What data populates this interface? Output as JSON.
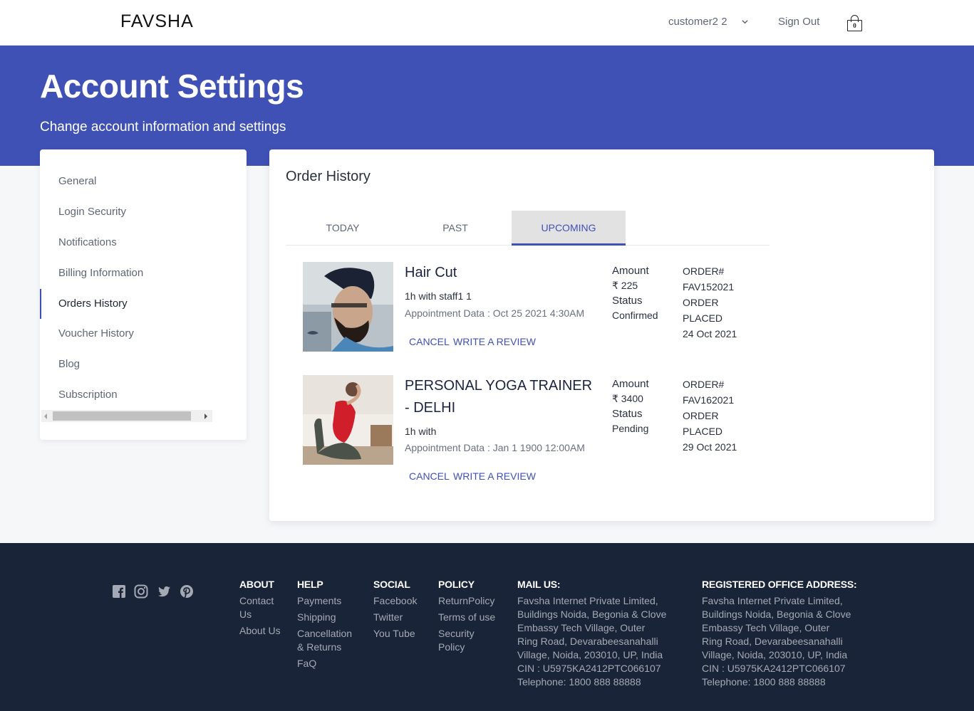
{
  "nav": {
    "logo": "FAVSHA",
    "user_name": "customer2 2",
    "sign_out": "Sign Out",
    "cart_count": "0"
  },
  "hero": {
    "title": "Account Settings",
    "subtitle": "Change account information and settings"
  },
  "sidebar": {
    "active": "Orders History",
    "items": [
      {
        "label": "General"
      },
      {
        "label": "Login Security"
      },
      {
        "label": "Notifications"
      },
      {
        "label": "Billing Information"
      },
      {
        "label": "Orders History"
      },
      {
        "label": "Voucher History"
      },
      {
        "label": "Blog"
      },
      {
        "label": "Subscription"
      }
    ]
  },
  "main": {
    "title": "Order History",
    "tabs": [
      {
        "label": "TODAY"
      },
      {
        "label": "PAST"
      },
      {
        "label": "UPCOMING"
      }
    ],
    "active_tab": "UPCOMING",
    "orders": [
      {
        "title": "Hair Cut",
        "duration": "1h with staff1 1",
        "appointment": "Appointment Data : Oct 25 2021 4:30AM",
        "amount_label": "Amount",
        "amount": "₹ 225",
        "status_label": "Status",
        "status": "Confirmed",
        "order_label": "ORDER#",
        "order_id": "FAV152021",
        "order_state_1": "ORDER",
        "order_state_2": "PLACED",
        "order_date": "24 Oct 2021",
        "cancel": "CANCEL",
        "review": "WRITE A REVIEW",
        "image": "haircut-photo"
      },
      {
        "title": "PERSONAL YOGA TRAINER - DELHI",
        "duration": "1h with",
        "appointment": "Appointment Data : Jan 1 1900 12:00AM",
        "amount_label": "Amount",
        "amount": "₹ 3400",
        "status_label": "Status",
        "status": "Pending",
        "order_label": "ORDER#",
        "order_id": "FAV162021",
        "order_state_1": "ORDER",
        "order_state_2": "PLACED",
        "order_date": "29 Oct 2021",
        "cancel": "CANCEL",
        "review": "WRITE A REVIEW",
        "image": "yoga-photo"
      }
    ]
  },
  "footer": {
    "social_icons": [
      "facebook-icon",
      "instagram-icon",
      "twitter-icon",
      "pinterest-icon"
    ],
    "about": {
      "heading": "ABOUT",
      "links": [
        "Contact Us",
        "About Us"
      ]
    },
    "help": {
      "heading": "HELP",
      "links": [
        "Payments",
        "Shipping",
        "Cancellation & Returns",
        "FaQ"
      ]
    },
    "social": {
      "heading": "SOCIAL",
      "links": [
        "Facebook",
        "Twitter",
        "You Tube"
      ]
    },
    "policy": {
      "heading": "POLICY",
      "links": [
        "ReturnPolicy",
        "Terms of use",
        "Security Policy"
      ]
    },
    "mail": {
      "heading": "MAIL US:",
      "text": "Favsha Internet Private Limited, Buildings Noida, Begonia & Clove Embassy Tech Village, Outer Ring Road, Devarabeesanahalli Village, Noida, 203010, UP, India CIN : U5975KA2412PTC066107 Telephone: 1800 888 88888"
    },
    "office": {
      "heading": "REGISTERED OFFICE ADDRESS:",
      "text": "Favsha Internet Private Limited, Buildings Noida, Begonia & Clove Embassy Tech Village, Outer Ring Road, Devarabeesanahalli Village, Noida, 203010, UP, India CIN : U5975KA2412PTC066107 Telephone: 1800 888 88888"
    }
  },
  "colors": {
    "brand": "#3f51b5",
    "footer_bg": "#1a2438",
    "page_bg": "#f6f7f9"
  }
}
